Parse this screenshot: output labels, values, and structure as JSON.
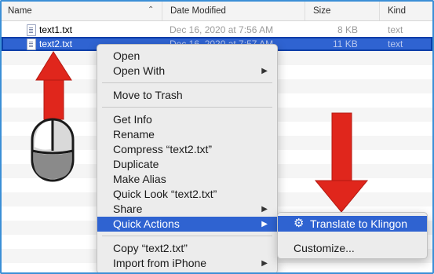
{
  "header": {
    "name": "Name",
    "date_modified": "Date Modified",
    "size": "Size",
    "kind": "Kind"
  },
  "files": [
    {
      "name": "text1.txt",
      "date": "Dec 16, 2020 at 7:56 AM",
      "size": "8 KB",
      "kind": "text",
      "selected": false
    },
    {
      "name": "text2.txt",
      "date": "Dec 16, 2020 at 7:57 AM",
      "size": "11 KB",
      "kind": "text",
      "selected": true
    }
  ],
  "context_menu": {
    "open": "Open",
    "open_with": "Open With",
    "move_to_trash": "Move to Trash",
    "get_info": "Get Info",
    "rename": "Rename",
    "compress": "Compress “text2.txt”",
    "duplicate": "Duplicate",
    "make_alias": "Make Alias",
    "quick_look": "Quick Look “text2.txt”",
    "share": "Share",
    "quick_actions": "Quick Actions",
    "copy": "Copy “text2.txt”",
    "import_from_iphone": "Import from iPhone"
  },
  "submenu": {
    "translate": "Translate to Klingon",
    "customize": "Customize..."
  },
  "colors": {
    "selection": "#2f63d1",
    "annotation_arrow": "#e0261c",
    "frame": "#3b8fd6"
  },
  "icons": {
    "sort": "chevron-up-down-icon",
    "submenu_arrow": "triangle-right-icon",
    "action": "gear-icon",
    "file": "text-document-icon",
    "mouse": "mouse-icon"
  }
}
